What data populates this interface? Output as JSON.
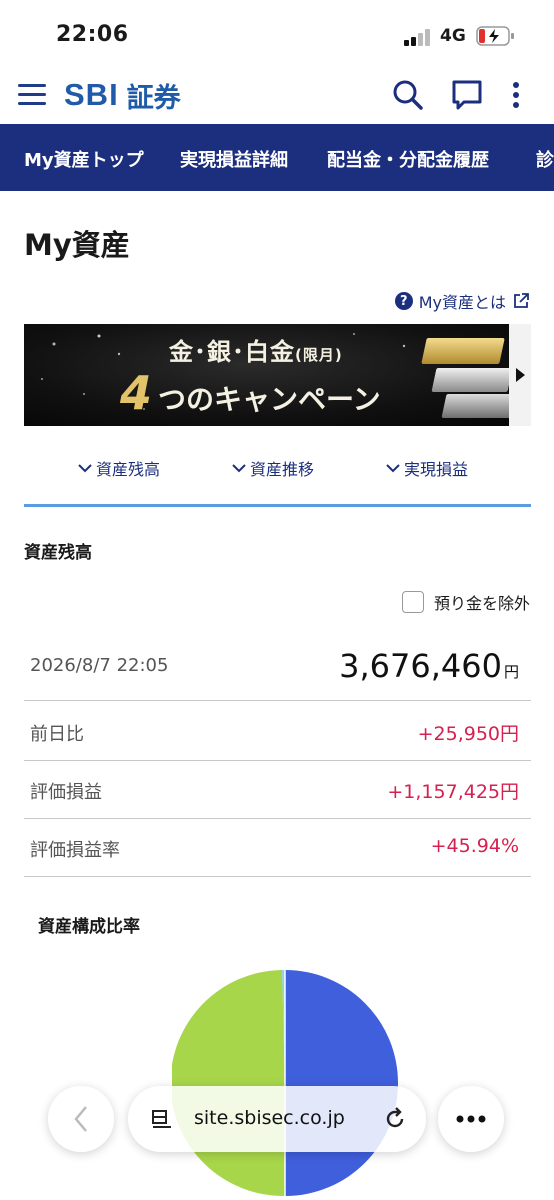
{
  "status": {
    "time": "22:06",
    "network": "4G"
  },
  "header": {
    "logo_sbi": "SBI",
    "logo_sub": "証券"
  },
  "tabs": [
    {
      "label": "My資産トップ"
    },
    {
      "label": "実現損益詳細"
    },
    {
      "label": "配当金・分配金履歴"
    },
    {
      "label": "診"
    }
  ],
  "page": {
    "title": "My資産",
    "about_link": "My資産とは"
  },
  "banner": {
    "line1_main": "金･銀･白金",
    "line1_sub": "(限月)",
    "number": "4",
    "campaign": "つのキャンペーン"
  },
  "jump_links": [
    {
      "label": "資産残高"
    },
    {
      "label": "資産推移"
    },
    {
      "label": "実現損益"
    }
  ],
  "balance": {
    "section_title": "資産残高",
    "exclude_deposit_label": "預り金を除外",
    "exclude_deposit_checked": false,
    "datetime": "2026/8/7 22:05",
    "total": "3,676,460",
    "total_unit": "円",
    "rows": [
      {
        "label": "前日比",
        "value": "+25,950円"
      },
      {
        "label": "評価損益",
        "value": "+1,157,425円"
      },
      {
        "label": "評価損益率",
        "value": "+45.94%"
      }
    ]
  },
  "composition": {
    "title": "資産構成比率",
    "segment_colors": [
      "#3f5fdc",
      "#a8d64a",
      "#8fd3e8"
    ]
  },
  "browser": {
    "url": "site.sbisec.co.jp"
  },
  "colors": {
    "brand_navy": "#1c2f7f",
    "positive": "#d6204f",
    "link_blue": "#5b9be0"
  }
}
